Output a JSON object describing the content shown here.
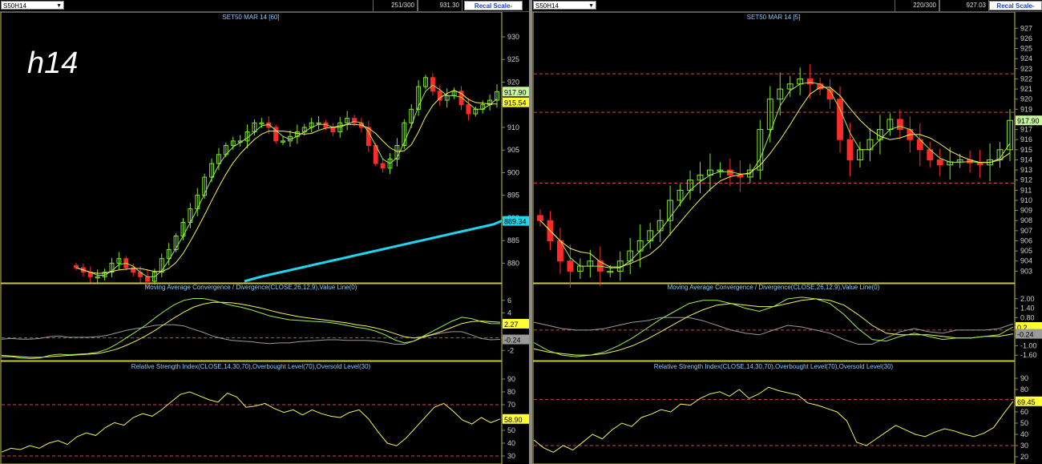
{
  "watermark": "h14",
  "panes": [
    {
      "symbol": "S50H14",
      "counter": "251/300",
      "price_cell": "931.30",
      "recal": "Recal Scale-Linear",
      "price_title": "SET50 MAR 14  [60]",
      "macd_title": "Moving Average Convergence / Divergence(CLOSE,26,12,9),Value Line(0)",
      "rsi_title": "Relative Strength Index(CLOSE,14,30,70),Overbought Level(70),Oversold Level(30)"
    },
    {
      "symbol": "S50H14",
      "counter": "220/300",
      "price_cell": "927.03",
      "recal": "Recal Scale-Linear",
      "price_title": "SET50 MAR 14  [5]",
      "macd_title": "Moving Average Convergence / Divergence(CLOSE,26,12,9),Value Line(0)",
      "rsi_title": "Relative Strength Index(CLOSE,14,30,70),Overbought Level(70),Oversold Level(30)"
    }
  ],
  "colors": {
    "up": "#7fe81f",
    "down": "#ff2a2a",
    "ma": "#f3f35a",
    "ma_fast": "#9cf04a",
    "long_ma": "#20d6ef",
    "axis": "#d0d0d0",
    "title": "#8cc8ff",
    "ref": "#d04a4a"
  },
  "chart_data": [
    {
      "type": "candlestick",
      "title": "SET50 MAR 14  [60]",
      "x": [
        1,
        2,
        3,
        4,
        5,
        6,
        7,
        8,
        9,
        10,
        11,
        12,
        13,
        14,
        15,
        16,
        17,
        18,
        19,
        20,
        21,
        22,
        23,
        24,
        25,
        26,
        27,
        28,
        29,
        30,
        31,
        32,
        33,
        34,
        35,
        36,
        37,
        38,
        39,
        40,
        41,
        42,
        43,
        44,
        45,
        46,
        47,
        48,
        49,
        50,
        51,
        52,
        53,
        54,
        55,
        56,
        57,
        58,
        59,
        60
      ],
      "close": [
        879,
        878,
        877,
        877,
        878,
        880,
        881,
        879,
        878,
        877,
        876,
        878,
        881,
        883,
        886,
        889,
        892,
        895,
        899,
        902,
        904,
        906,
        907,
        907,
        909,
        911,
        911,
        910,
        907,
        907,
        908,
        909,
        910,
        911,
        911,
        910,
        909,
        911,
        912,
        911,
        910,
        906,
        902,
        901,
        903,
        906,
        911,
        914,
        919,
        921,
        918,
        916,
        917,
        918,
        915,
        913,
        914,
        915,
        916,
        917.9
      ],
      "ylim": [
        876,
        933
      ],
      "ytick_labels": [
        "930",
        "925",
        "920",
        "915",
        "910",
        "905",
        "900",
        "895",
        "890",
        "885",
        "880"
      ],
      "last_labels": [
        "917.90",
        "915.54",
        "889.34"
      ],
      "long_ma": [
        876,
        876.5,
        877,
        877.4,
        877.8,
        878.2,
        878.6,
        879,
        879.4,
        879.8,
        880.2,
        880.6,
        881,
        881.4,
        881.8,
        882.2,
        882.6,
        883,
        883.4,
        883.8,
        884.2,
        884.6,
        885,
        885.4,
        885.8,
        886.2,
        886.6,
        887,
        887.4,
        887.8,
        888.2,
        888.6,
        889.34
      ]
    },
    {
      "type": "line",
      "title": "Moving Average Convergence / Divergence(CLOSE,26,12,9),Value Line(0)",
      "ylim": [
        -3.5,
        7
      ],
      "ytick_labels": [
        "6",
        "4",
        "2",
        "0",
        "-2"
      ],
      "macd": [
        -3,
        -3,
        -3.2,
        -3.3,
        -3.2,
        -2.8,
        -2.6,
        -2.7,
        -2.6,
        -2.5,
        -2.3,
        -1.8,
        -1,
        0,
        1,
        2,
        3.2,
        4.3,
        5.3,
        6,
        6.3,
        6.3,
        6,
        5.6,
        5.2,
        4.9,
        4.5,
        4,
        3.5,
        3.2,
        2.9,
        2.8,
        2.7,
        2.6,
        2.5,
        2.3,
        2,
        1.7,
        1.5,
        1.1,
        0.5,
        -0.3,
        -0.8,
        -0.5,
        0.3,
        1.1,
        1.9,
        2.7,
        3.3,
        3.1,
        2.6,
        2.3,
        2.27
      ],
      "signal": [
        -2.8,
        -2.9,
        -3,
        -3.1,
        -3.1,
        -3,
        -2.9,
        -2.8,
        -2.7,
        -2.6,
        -2.5,
        -2.2,
        -1.8,
        -1.2,
        -0.5,
        0.3,
        1.2,
        2.2,
        3.2,
        4.1,
        4.9,
        5.4,
        5.7,
        5.7,
        5.6,
        5.4,
        5.1,
        4.8,
        4.4,
        4,
        3.7,
        3.4,
        3.2,
        3,
        2.8,
        2.6,
        2.4,
        2.1,
        1.9,
        1.6,
        1.2,
        0.7,
        0.2,
        0,
        0.2,
        0.6,
        1.1,
        1.7,
        2.3,
        2.6,
        2.7,
        2.6,
        2.5
      ],
      "hist": [
        -0.2,
        -0.1,
        -0.2,
        -0.2,
        -0.1,
        0.2,
        0.3,
        0.1,
        0.1,
        0.1,
        0.2,
        0.4,
        0.8,
        1.2,
        1.5,
        1.7,
        2,
        2.1,
        2.1,
        1.9,
        1.4,
        0.9,
        0.3,
        -0.1,
        -0.4,
        -0.5,
        -0.6,
        -0.8,
        -0.9,
        -0.8,
        -0.8,
        -0.6,
        -0.5,
        -0.4,
        -0.3,
        -0.3,
        -0.4,
        -0.4,
        -0.4,
        -0.5,
        -0.7,
        -1,
        -1,
        -0.5,
        0.1,
        0.5,
        0.8,
        1,
        1,
        0.5,
        -0.1,
        -0.3,
        -0.24
      ],
      "last_labels": [
        "2.27",
        "-0.24"
      ]
    },
    {
      "type": "line",
      "title": "Relative Strength Index(CLOSE,14,30,70),Overbought Level(70),Oversold Level(30)",
      "ylim": [
        25,
        95
      ],
      "ytick_labels": [
        "90",
        "80",
        "70",
        "60",
        "50",
        "40",
        "30"
      ],
      "values": [
        33,
        36,
        35,
        38,
        36,
        40,
        42,
        39,
        45,
        48,
        46,
        52,
        56,
        54,
        60,
        63,
        61,
        66,
        72,
        78,
        80,
        77,
        74,
        72,
        79,
        76,
        68,
        69,
        71,
        67,
        64,
        66,
        62,
        66,
        63,
        61,
        60,
        64,
        66,
        59,
        49,
        40,
        38,
        44,
        52,
        60,
        68,
        71,
        65,
        58,
        55,
        60,
        56,
        58.9
      ],
      "ref_levels": [
        70,
        30
      ],
      "last_labels": [
        "58.90"
      ]
    },
    {
      "type": "candlestick",
      "title": "SET50 MAR 14  [5]",
      "close": [
        908,
        906,
        904,
        903,
        903.5,
        904,
        903,
        903,
        904,
        905,
        906,
        907,
        908,
        910,
        911,
        912,
        912.5,
        913,
        913,
        912.5,
        912.3,
        913,
        917,
        920,
        921,
        921.5,
        922,
        921.5,
        921,
        920,
        916,
        914,
        915,
        916,
        917,
        918,
        917,
        916,
        915,
        914,
        913.5,
        913.8,
        914,
        913.7,
        913.5,
        914,
        915,
        917.9
      ],
      "ylim": [
        902,
        927.5
      ],
      "ytick_labels": [
        "927",
        "926",
        "925",
        "924",
        "923",
        "922",
        "921",
        "920",
        "919",
        "918",
        "917",
        "916",
        "915",
        "914",
        "913",
        "912",
        "911",
        "910",
        "909",
        "908",
        "907",
        "906",
        "905",
        "904",
        "903"
      ],
      "ref_levels": [
        922.5,
        918.7,
        911.7
      ],
      "last_labels": [
        "917.90"
      ]
    },
    {
      "type": "line",
      "title": "Moving Average Convergence / Divergence(CLOSE,26,12,9),Value Line(0)",
      "ylim": [
        -1.9,
        2.3
      ],
      "ytick_labels": [
        "2.00",
        "1.40",
        "0.80",
        "0.20",
        "-0.40",
        "-1.00",
        "-1.60"
      ],
      "macd": [
        -0.8,
        -1.3,
        -1.6,
        -1.7,
        -1.6,
        -1.4,
        -1,
        -0.5,
        0.1,
        0.7,
        1.2,
        1.7,
        1.9,
        1.9,
        1.7,
        1.4,
        1.2,
        1.5,
        2,
        2.1,
        2,
        1.7,
        1,
        0.1,
        -0.6,
        -0.7,
        -0.4,
        -0.2,
        -0.4,
        -0.6,
        -0.5,
        -0.5,
        -0.4,
        -0.3,
        0.2
      ],
      "signal": [
        -1.2,
        -1.4,
        -1.5,
        -1.6,
        -1.6,
        -1.5,
        -1.3,
        -1,
        -0.6,
        -0.1,
        0.4,
        0.9,
        1.3,
        1.6,
        1.7,
        1.6,
        1.5,
        1.5,
        1.7,
        1.9,
        2,
        1.9,
        1.6,
        1,
        0.3,
        -0.2,
        -0.3,
        -0.3,
        -0.3,
        -0.4,
        -0.5,
        -0.5,
        -0.4,
        -0.4,
        -0.24
      ],
      "hist": [
        0.5,
        0.3,
        0.1,
        0,
        0,
        0.1,
        0.3,
        0.5,
        0.6,
        0.8,
        0.8,
        0.8,
        0.6,
        0.3,
        0,
        -0.2,
        -0.3,
        0,
        0.3,
        0.2,
        0,
        -0.2,
        -0.6,
        -0.9,
        -0.9,
        -0.5,
        -0.1,
        0.1,
        -0.1,
        -0.2,
        0,
        0,
        0,
        0.1,
        0.4
      ],
      "last_labels": [
        "0.2",
        "-0.24"
      ]
    },
    {
      "type": "line",
      "title": "Relative Strength Index(CLOSE,14,30,70),Overbought Level(70),Oversold Level(30)",
      "ylim": [
        15,
        95
      ],
      "ytick_labels": [
        "90",
        "80",
        "70",
        "60",
        "50",
        "40",
        "30",
        "20"
      ],
      "values": [
        35,
        28,
        24,
        30,
        26,
        33,
        40,
        36,
        44,
        50,
        47,
        55,
        58,
        62,
        60,
        67,
        66,
        72,
        76,
        78,
        74,
        80,
        72,
        76,
        82,
        79,
        77,
        75,
        68,
        66,
        63,
        60,
        52,
        33,
        30,
        36,
        42,
        48,
        44,
        40,
        38,
        42,
        45,
        43,
        40,
        38,
        41,
        46,
        58,
        69.45
      ],
      "ref_levels": [
        71,
        30
      ],
      "last_labels": [
        "69.45"
      ]
    }
  ]
}
